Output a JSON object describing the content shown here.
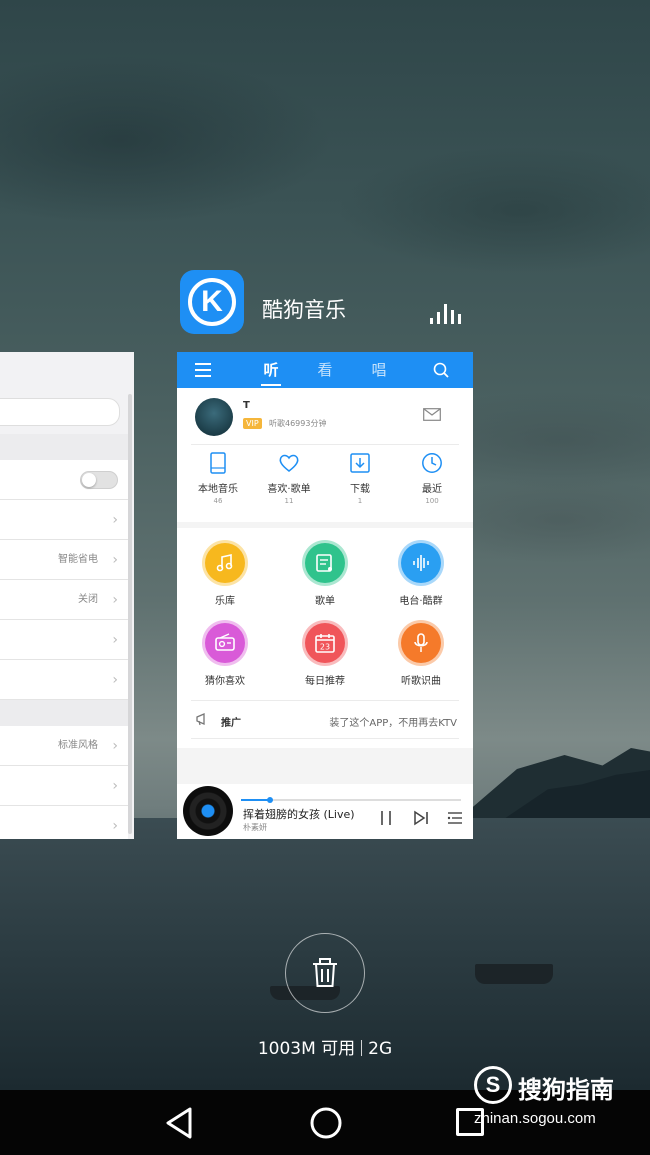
{
  "app": {
    "name": "酷狗音乐",
    "logo_letter": "K",
    "brand_color": "#1e8ff4"
  },
  "left_card": {
    "rows": [
      {
        "value": ""
      },
      {
        "value": ""
      },
      {
        "value": "智能省电"
      },
      {
        "value": "关闭"
      },
      {
        "value": ""
      },
      {
        "value": ""
      },
      {
        "value": "标准风格"
      },
      {
        "value": ""
      },
      {
        "value": ""
      }
    ]
  },
  "kugou": {
    "tabs": [
      "听",
      "看",
      "唱"
    ],
    "active_tab": "听",
    "user": {
      "name": "T",
      "vip": "VIP",
      "listen": "听歌46993分钟"
    },
    "quick": [
      {
        "label": "本地音乐",
        "count": "46",
        "icon": "tablet-icon"
      },
      {
        "label": "喜欢·歌单",
        "count": "11",
        "icon": "heart-icon"
      },
      {
        "label": "下载",
        "count": "1",
        "icon": "download-icon"
      },
      {
        "label": "最近",
        "count": "100",
        "icon": "clock-icon"
      }
    ],
    "grid": [
      {
        "label": "乐库",
        "color": "#f7b81e",
        "icon": "music-note-icon"
      },
      {
        "label": "歌单",
        "color": "#2fc38c",
        "icon": "playlist-icon"
      },
      {
        "label": "电台·酷群",
        "color": "#2a9ff2",
        "icon": "radio-wave-icon"
      },
      {
        "label": "猜你喜欢",
        "color": "#d95ad8",
        "icon": "radio-icon"
      },
      {
        "label": "每日推荐",
        "color": "#f0555a",
        "icon": "calendar-icon",
        "badge": "23"
      },
      {
        "label": "听歌识曲",
        "color": "#f57a2a",
        "icon": "microphone-icon"
      }
    ],
    "promo": {
      "label": "推广",
      "text": "装了这个APP，不用再去KTV"
    },
    "player": {
      "song": "挥着翅膀的女孩 (Live)",
      "artist": "朴素妍",
      "progress": 0.13
    }
  },
  "bottom": {
    "memory": "1003M 可用",
    "total": "2G"
  },
  "watermark": {
    "logo": "S",
    "title": "搜狗指南",
    "url": "zhinan.sogou.com"
  }
}
